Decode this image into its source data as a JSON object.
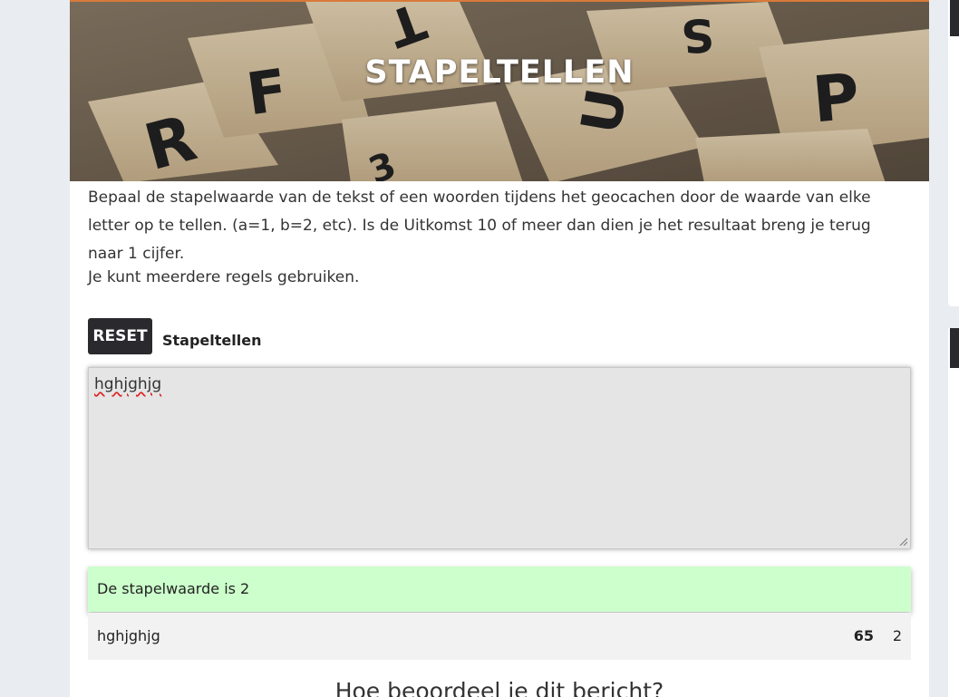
{
  "hero": {
    "title": "STAPELTELLEN"
  },
  "intro": {
    "paragraph1": "Bepaal de stapelwaarde van de tekst of een woorden tijdens het geocachen door de waarde van elke letter op te tellen. (a=1, b=2, etc). Is de Uitkomst 10 of meer dan dien je het resultaat breng je terug naar 1 cijfer.",
    "paragraph2": "Je kunt meerdere regels gebruiken."
  },
  "tool": {
    "reset_label": "RESET",
    "label": "Stapeltellen",
    "input_value": "hghjghjg"
  },
  "result": {
    "text": "De stapelwaarde is 2"
  },
  "rows": [
    {
      "word": "hghjghjg",
      "sum": "65",
      "digit": "2"
    }
  ],
  "rating": {
    "title": "Hoe beoordeel je dit bericht?"
  },
  "colors": {
    "result_background": "#ccffcc",
    "reset_button": "#2a2a2e",
    "accent_line": "#d87a3a"
  }
}
